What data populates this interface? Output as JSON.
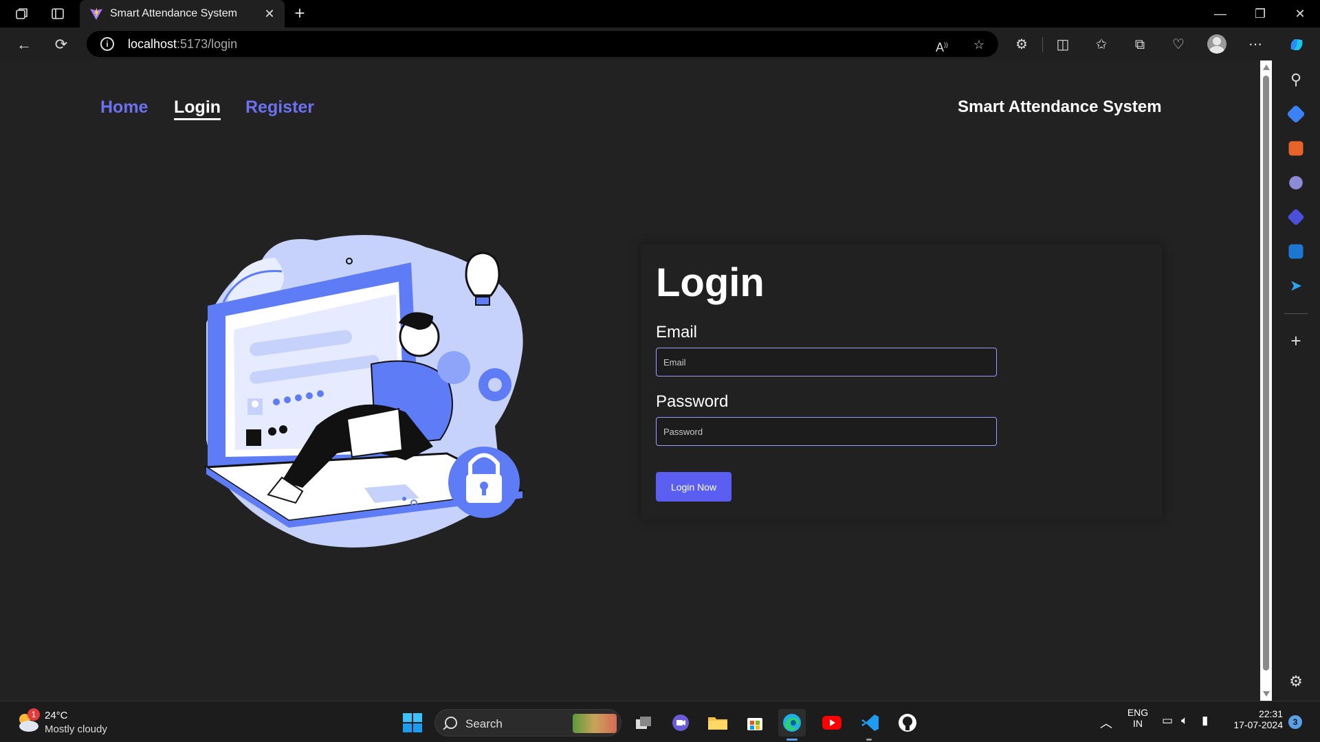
{
  "browser": {
    "tab_title": "Smart Attendance System",
    "url_host": "localhost",
    "url_path": ":5173/login"
  },
  "nav": {
    "links": [
      "Home",
      "Login",
      "Register"
    ],
    "brand": "Smart Attendance System"
  },
  "login": {
    "heading": "Login",
    "email_label": "Email",
    "email_placeholder": "Email",
    "password_label": "Password",
    "password_placeholder": "Password",
    "submit_label": "Login Now"
  },
  "taskbar": {
    "weather_temp": "24°C",
    "weather_condition": "Mostly cloudy",
    "weather_badge": "1",
    "search_label": "Search",
    "lang_top": "ENG",
    "lang_bottom": "IN",
    "time": "22:31",
    "date": "17-07-2024",
    "notif_count": "3"
  },
  "colors": {
    "accent": "#5b5ff1",
    "link": "#6b71f0",
    "background": "#222223",
    "illustration": "#5e7cf5"
  }
}
